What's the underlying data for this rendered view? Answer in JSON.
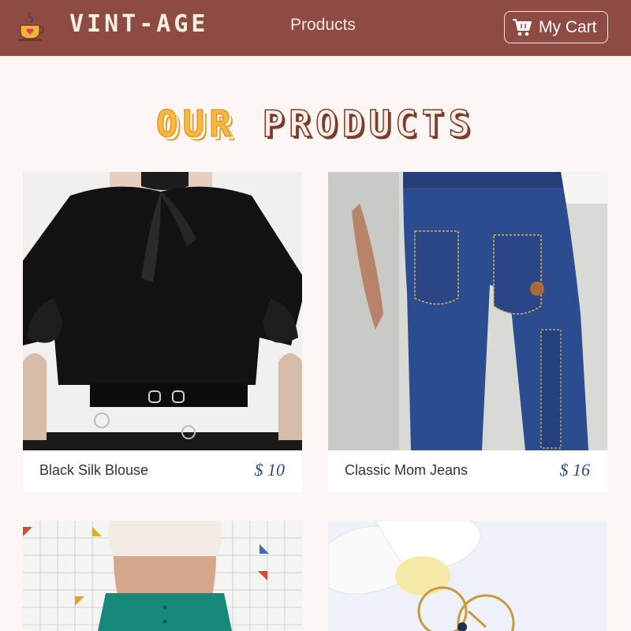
{
  "nav": {
    "brand": "VINT-AGE",
    "logo_icon": "coffee-cup-heart-icon",
    "products_link": "Products",
    "cart_label": "My Cart",
    "cart_icon": "shopping-cart-icon"
  },
  "heading": {
    "word1": "OUR",
    "word2": "PRODUCTS"
  },
  "products": [
    {
      "name": "Black Silk Blouse",
      "price": "$ 10",
      "image": "black-blouse-photo"
    },
    {
      "name": "Classic Mom Jeans",
      "price": "$ 16",
      "image": "mom-jeans-photo"
    },
    {
      "name": "",
      "price": "",
      "image": "teal-skirt-photo"
    },
    {
      "name": "",
      "price": "",
      "image": "gold-earrings-photo"
    }
  ],
  "colors": {
    "navbar": "#8d4b43",
    "background": "#fcf6f5",
    "accent_orange": "#fdb642",
    "price_blue": "#2e4a7d"
  }
}
